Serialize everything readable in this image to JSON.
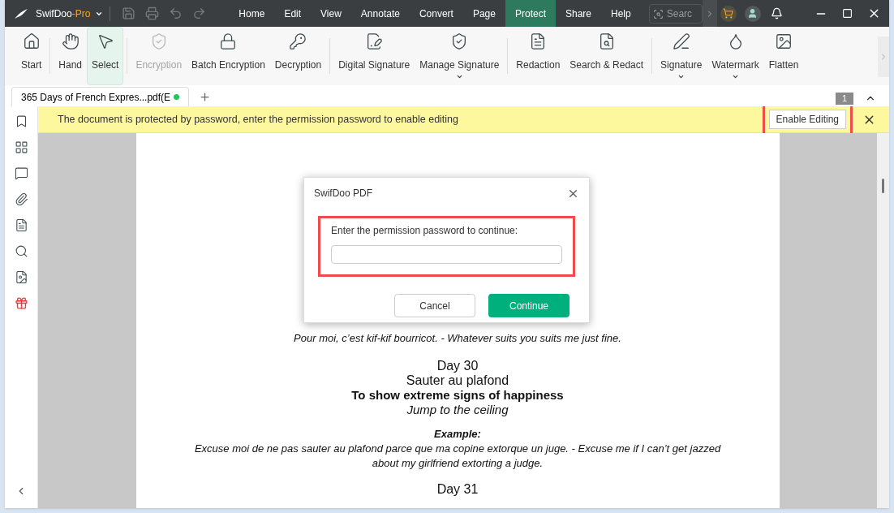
{
  "app": {
    "name": "SwifDoo",
    "suffix": "-Pro"
  },
  "menu": [
    {
      "label": "Home",
      "selected": false
    },
    {
      "label": "Edit",
      "selected": false
    },
    {
      "label": "View",
      "selected": false
    },
    {
      "label": "Annotate",
      "selected": false
    },
    {
      "label": "Convert",
      "selected": false
    },
    {
      "label": "Page",
      "selected": false
    },
    {
      "label": "Protect",
      "selected": true
    },
    {
      "label": "Share",
      "selected": false
    },
    {
      "label": "Help",
      "selected": false
    }
  ],
  "search": {
    "placeholder": "Searc"
  },
  "toolbar": [
    [
      {
        "label": "Start",
        "selected": false,
        "disabled": false,
        "dropdown": false
      }
    ],
    [
      {
        "label": "Hand",
        "selected": false,
        "disabled": false,
        "dropdown": false
      },
      {
        "label": "Select",
        "selected": true,
        "disabled": false,
        "dropdown": false
      }
    ],
    [
      {
        "label": "Encryption",
        "selected": false,
        "disabled": true,
        "dropdown": false
      },
      {
        "label": "Batch Encryption",
        "selected": false,
        "disabled": false,
        "dropdown": false
      },
      {
        "label": "Decryption",
        "selected": false,
        "disabled": false,
        "dropdown": false
      }
    ],
    [
      {
        "label": "Digital Signature",
        "selected": false,
        "disabled": false,
        "dropdown": false
      },
      {
        "label": "Manage Signature",
        "selected": false,
        "disabled": false,
        "dropdown": true
      }
    ],
    [
      {
        "label": "Redaction",
        "selected": false,
        "disabled": false,
        "dropdown": false
      },
      {
        "label": "Search & Redact",
        "selected": false,
        "disabled": false,
        "dropdown": false
      }
    ],
    [
      {
        "label": "Signature",
        "selected": false,
        "disabled": false,
        "dropdown": true
      },
      {
        "label": "Watermark",
        "selected": false,
        "disabled": false,
        "dropdown": true
      },
      {
        "label": "Flatten",
        "selected": false,
        "disabled": false,
        "dropdown": false
      }
    ]
  ],
  "tabs": [
    {
      "label": "365 Days of French Expres...pdf(E",
      "selected": true,
      "modified": true
    }
  ],
  "page_count": "1",
  "banner": {
    "message": "The document is protected by password, enter the permission password to enable editing",
    "button": "Enable Editing",
    "highlighted": true
  },
  "document": [
    {
      "text": "Pour moi, c’est kif-kif bourricot. - Whatever suits you suits me just fine.",
      "kind": "italic"
    },
    {
      "text": "Day 30",
      "kind": "heading"
    },
    {
      "text": "Sauter au plafond",
      "kind": "heading"
    },
    {
      "text": "To show extreme signs of happiness",
      "kind": "bold"
    },
    {
      "text": "Jump to the ceiling",
      "kind": "emphasis"
    },
    {
      "text": "Example:",
      "kind": "label"
    },
    {
      "text": "Excuse moi de ne pas sauter au plafond parce que ma copine extorque un juge. - Excuse me if I can’t get jazzed about my girlfriend extorting a judge.",
      "kind": "italic"
    },
    {
      "text": "Day 31",
      "kind": "heading"
    }
  ],
  "dialog": {
    "title": "SwifDoo PDF",
    "prompt": "Enter the permission password to continue:",
    "highlighted": true,
    "buttons": [
      {
        "label": "Cancel",
        "kind": "secondary"
      },
      {
        "label": "Continue",
        "kind": "primary"
      }
    ]
  }
}
